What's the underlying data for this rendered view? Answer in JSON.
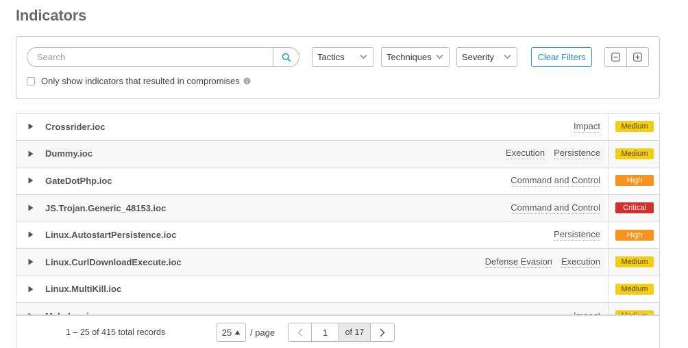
{
  "page": {
    "title": "Indicators"
  },
  "filters": {
    "search_placeholder": "Search",
    "tactics_label": "Tactics",
    "techniques_label": "Techniques",
    "severity_label": "Severity",
    "clear_label": "Clear Filters",
    "compromise_label": "Only show indicators that resulted in compromises",
    "compromise_checked": false
  },
  "indicators": [
    {
      "name": "Crossrider.ioc",
      "tactics": [
        "Impact"
      ],
      "severity": "Medium"
    },
    {
      "name": "Dummy.ioc",
      "tactics": [
        "Execution",
        "Persistence"
      ],
      "severity": "Medium"
    },
    {
      "name": "GateDotPhp.ioc",
      "tactics": [
        "Command and Control"
      ],
      "severity": "High"
    },
    {
      "name": "JS.Trojan.Generic_48153.ioc",
      "tactics": [
        "Command and Control"
      ],
      "severity": "Critical"
    },
    {
      "name": "Linux.AutostartPersistence.ioc",
      "tactics": [
        "Persistence"
      ],
      "severity": "High"
    },
    {
      "name": "Linux.CurlDownloadExecute.ioc",
      "tactics": [
        "Defense Evasion",
        "Execution"
      ],
      "severity": "Medium"
    },
    {
      "name": "Linux.MultiKill.ioc",
      "tactics": [],
      "severity": "Medium"
    },
    {
      "name": "Mshelper.ioc",
      "tactics": [
        "Impact"
      ],
      "severity": "Medium"
    }
  ],
  "severity_colors": {
    "Medium": "#f4cd16",
    "High": "#f7931e",
    "Critical": "#d32f2f"
  },
  "pagination": {
    "records_text": "1 – 25 of 415 total records",
    "page_size": "25",
    "per_page_label": "/ page",
    "current_page": "1",
    "of_total": "of 17"
  },
  "icons": {
    "search": "search-icon",
    "chevron": "chevron-down-icon",
    "collapse_all": "minus-square-icon",
    "expand_all": "plus-square-icon",
    "info": "info-icon",
    "row_expand": "caret-right-icon",
    "sort": "caret-up-icon",
    "prev": "chevron-left-icon",
    "next": "chevron-right-icon"
  }
}
